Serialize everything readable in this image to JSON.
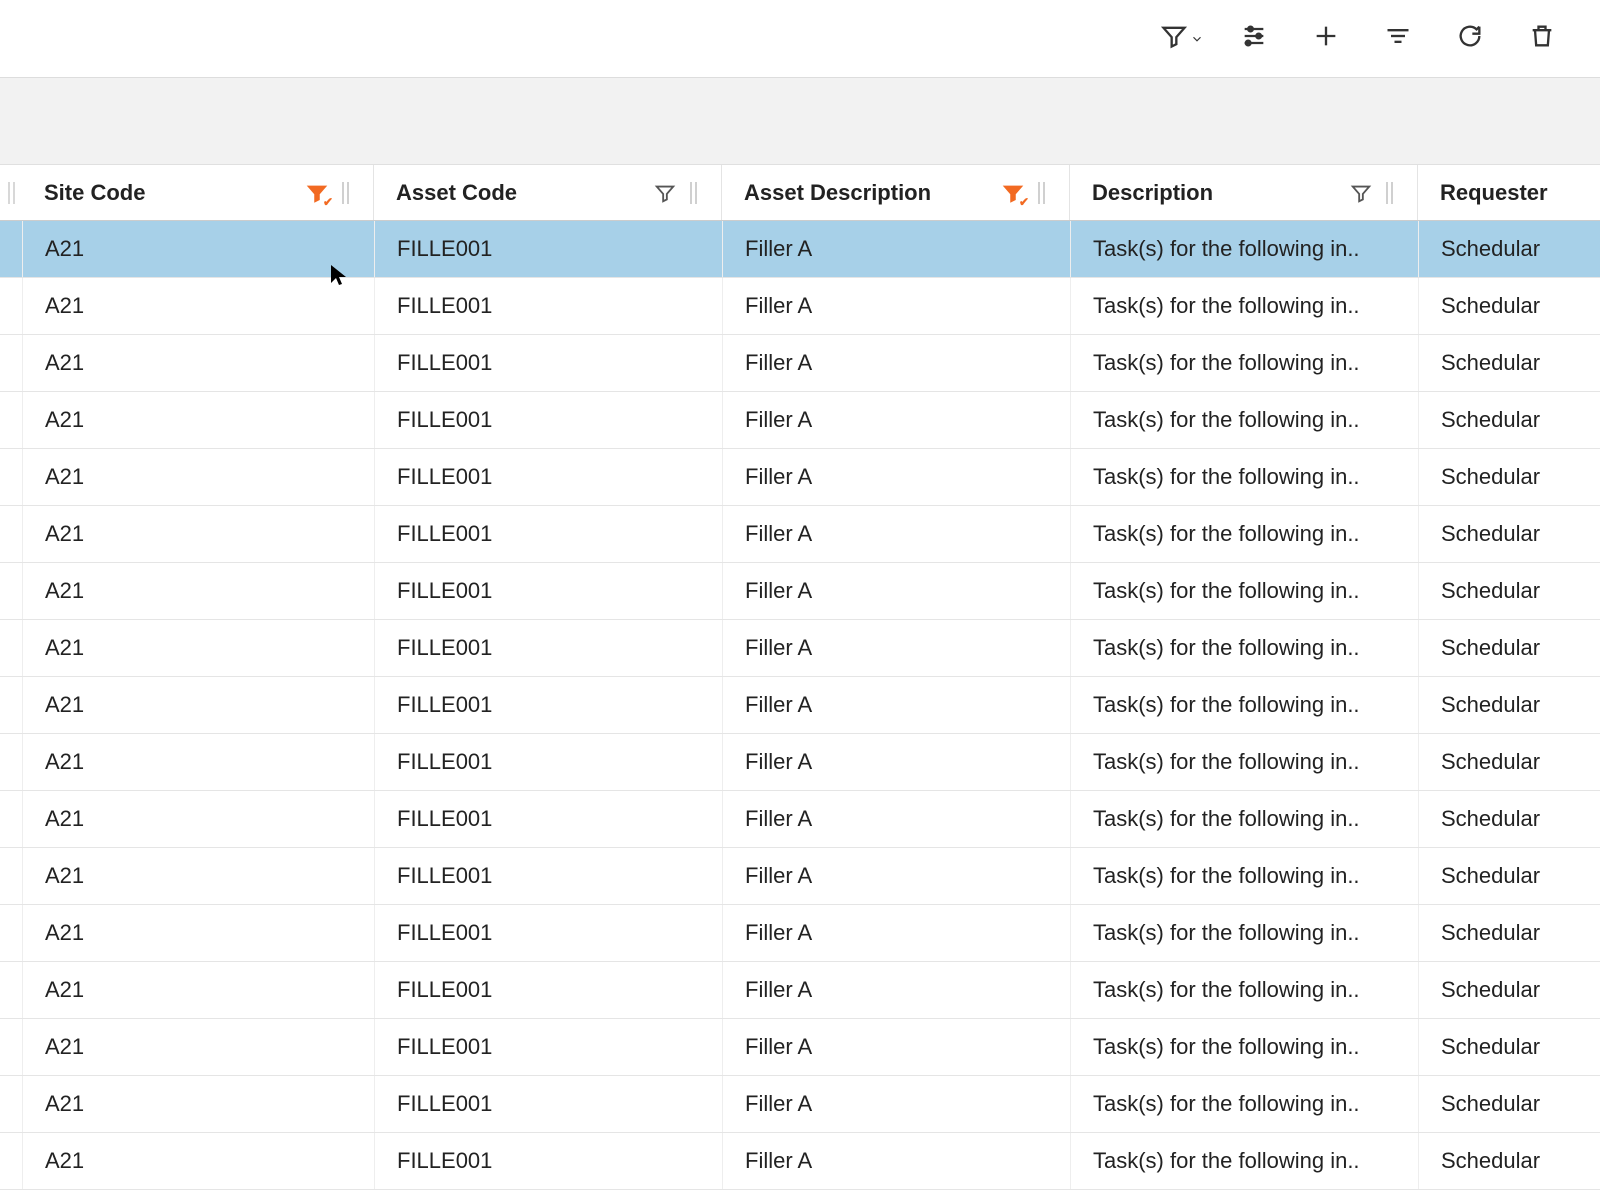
{
  "toolbar": {
    "filter_label": "Filter",
    "settings_label": "Settings",
    "add_label": "Add",
    "group_label": "Group",
    "refresh_label": "Refresh",
    "delete_label": "Delete"
  },
  "columns": {
    "site": {
      "label": "Site Code",
      "filtered": true
    },
    "asset": {
      "label": "Asset Code",
      "filtered": false
    },
    "assetdesc": {
      "label": "Asset Description",
      "filtered": true
    },
    "desc": {
      "label": "Description",
      "filtered": false
    },
    "requester": {
      "label": "Requester",
      "filtered": false
    }
  },
  "rows": [
    {
      "site": "A21",
      "asset": "FILLE001",
      "assetdesc": "Filler A",
      "desc": "Task(s) for the following in..",
      "requester": "Schedular",
      "selected": true
    },
    {
      "site": "A21",
      "asset": "FILLE001",
      "assetdesc": "Filler A",
      "desc": "Task(s) for the following in..",
      "requester": "Schedular",
      "selected": false
    },
    {
      "site": "A21",
      "asset": "FILLE001",
      "assetdesc": "Filler A",
      "desc": "Task(s) for the following in..",
      "requester": "Schedular",
      "selected": false
    },
    {
      "site": "A21",
      "asset": "FILLE001",
      "assetdesc": "Filler A",
      "desc": "Task(s) for the following in..",
      "requester": "Schedular",
      "selected": false
    },
    {
      "site": "A21",
      "asset": "FILLE001",
      "assetdesc": "Filler A",
      "desc": "Task(s) for the following in..",
      "requester": "Schedular",
      "selected": false
    },
    {
      "site": "A21",
      "asset": "FILLE001",
      "assetdesc": "Filler A",
      "desc": "Task(s) for the following in..",
      "requester": "Schedular",
      "selected": false
    },
    {
      "site": "A21",
      "asset": "FILLE001",
      "assetdesc": "Filler A",
      "desc": "Task(s) for the following in..",
      "requester": "Schedular",
      "selected": false
    },
    {
      "site": "A21",
      "asset": "FILLE001",
      "assetdesc": "Filler A",
      "desc": "Task(s) for the following in..",
      "requester": "Schedular",
      "selected": false
    },
    {
      "site": "A21",
      "asset": "FILLE001",
      "assetdesc": "Filler A",
      "desc": "Task(s) for the following in..",
      "requester": "Schedular",
      "selected": false
    },
    {
      "site": "A21",
      "asset": "FILLE001",
      "assetdesc": "Filler A",
      "desc": "Task(s) for the following in..",
      "requester": "Schedular",
      "selected": false
    },
    {
      "site": "A21",
      "asset": "FILLE001",
      "assetdesc": "Filler A",
      "desc": "Task(s) for the following in..",
      "requester": "Schedular",
      "selected": false
    },
    {
      "site": "A21",
      "asset": "FILLE001",
      "assetdesc": "Filler A",
      "desc": "Task(s) for the following in..",
      "requester": "Schedular",
      "selected": false
    },
    {
      "site": "A21",
      "asset": "FILLE001",
      "assetdesc": "Filler A",
      "desc": "Task(s) for the following in..",
      "requester": "Schedular",
      "selected": false
    },
    {
      "site": "A21",
      "asset": "FILLE001",
      "assetdesc": "Filler A",
      "desc": "Task(s) for the following in..",
      "requester": "Schedular",
      "selected": false
    },
    {
      "site": "A21",
      "asset": "FILLE001",
      "assetdesc": "Filler A",
      "desc": "Task(s) for the following in..",
      "requester": "Schedular",
      "selected": false
    },
    {
      "site": "A21",
      "asset": "FILLE001",
      "assetdesc": "Filler A",
      "desc": "Task(s) for the following in..",
      "requester": "Schedular",
      "selected": false
    },
    {
      "site": "A21",
      "asset": "FILLE001",
      "assetdesc": "Filler A",
      "desc": "Task(s) for the following in..",
      "requester": "Schedular",
      "selected": false
    }
  ],
  "colors": {
    "selected_row": "#a7d0e8",
    "active_filter": "#f26a22"
  }
}
